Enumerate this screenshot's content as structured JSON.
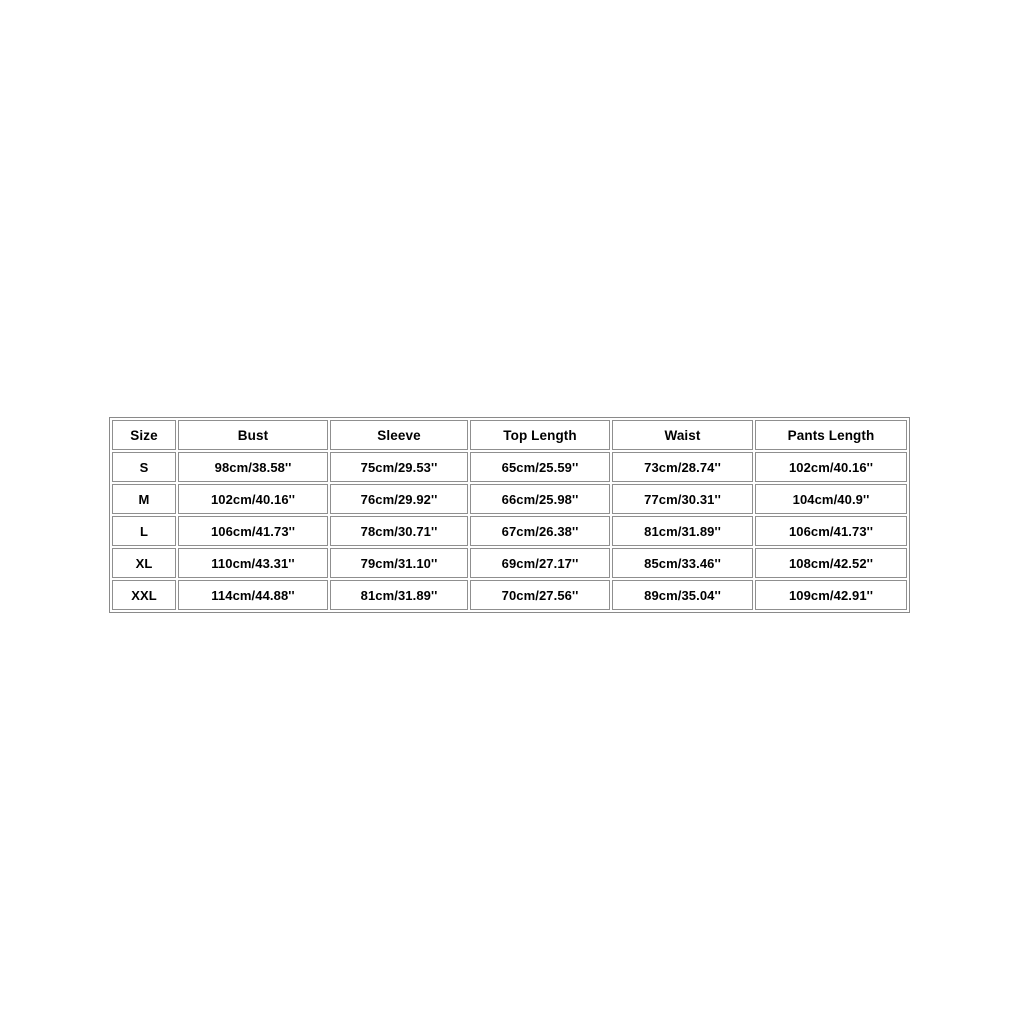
{
  "page": {
    "background_color": "#ffffff",
    "text_color": "#000000",
    "border_color": "#8f8f8f"
  },
  "size_chart": {
    "name": "clothing-size-chart",
    "columns": [
      {
        "key": "size",
        "label": "Size"
      },
      {
        "key": "bust",
        "label": "Bust"
      },
      {
        "key": "sleeve",
        "label": "Sleeve"
      },
      {
        "key": "top_length",
        "label": "Top Length"
      },
      {
        "key": "waist",
        "label": "Waist"
      },
      {
        "key": "pants_length",
        "label": "Pants Length"
      }
    ],
    "rows": [
      {
        "size": "S",
        "bust": "98cm/38.58''",
        "sleeve": "75cm/29.53''",
        "top_length": "65cm/25.59''",
        "waist": "73cm/28.74''",
        "pants_length": "102cm/40.16''"
      },
      {
        "size": "M",
        "bust": "102cm/40.16''",
        "sleeve": "76cm/29.92''",
        "top_length": "66cm/25.98''",
        "waist": "77cm/30.31''",
        "pants_length": "104cm/40.9''"
      },
      {
        "size": "L",
        "bust": "106cm/41.73''",
        "sleeve": "78cm/30.71''",
        "top_length": "67cm/26.38''",
        "waist": "81cm/31.89''",
        "pants_length": "106cm/41.73''"
      },
      {
        "size": "XL",
        "bust": "110cm/43.31''",
        "sleeve": "79cm/31.10''",
        "top_length": "69cm/27.17''",
        "waist": "85cm/33.46''",
        "pants_length": "108cm/42.52''"
      },
      {
        "size": "XXL",
        "bust": "114cm/44.88''",
        "sleeve": "81cm/31.89''",
        "top_length": "70cm/27.56''",
        "waist": "89cm/35.04''",
        "pants_length": "109cm/42.91''"
      }
    ]
  }
}
